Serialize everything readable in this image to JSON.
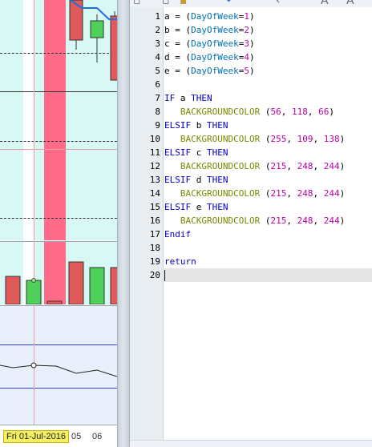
{
  "chart": {
    "date_axis": {
      "highlight_label": "Fri 01-Jul-2016",
      "ticks": [
        "05",
        "06"
      ]
    },
    "colors": {
      "panel_bg": "#d7f8f4",
      "highlight_band": "#ff6b88",
      "bearish_candle": "#e05a5a",
      "bullish_candle": "#4fd05a",
      "moving_average": "#1f6fe0",
      "indicator_bg": "#eaf0fb"
    }
  },
  "editor": {
    "line_numbers": [
      "1",
      "2",
      "3",
      "4",
      "5",
      "6",
      "7",
      "8",
      "9",
      "10",
      "11",
      "12",
      "13",
      "14",
      "15",
      "16",
      "17",
      "18",
      "19",
      "20"
    ],
    "current_line": 20,
    "lines": [
      [
        {
          "t": "a = (",
          "c": "plain"
        },
        {
          "t": "DayOfWeek",
          "c": "fn"
        },
        {
          "t": "=",
          "c": "plain"
        },
        {
          "t": "1",
          "c": "num"
        },
        {
          "t": ")",
          "c": "plain"
        }
      ],
      [
        {
          "t": "b = (",
          "c": "plain"
        },
        {
          "t": "DayOfWeek",
          "c": "fn"
        },
        {
          "t": "=",
          "c": "plain"
        },
        {
          "t": "2",
          "c": "num"
        },
        {
          "t": ")",
          "c": "plain"
        }
      ],
      [
        {
          "t": "c = (",
          "c": "plain"
        },
        {
          "t": "DayOfWeek",
          "c": "fn"
        },
        {
          "t": "=",
          "c": "plain"
        },
        {
          "t": "3",
          "c": "num"
        },
        {
          "t": ")",
          "c": "plain"
        }
      ],
      [
        {
          "t": "d = (",
          "c": "plain"
        },
        {
          "t": "DayOfWeek",
          "c": "fn"
        },
        {
          "t": "=",
          "c": "plain"
        },
        {
          "t": "4",
          "c": "num"
        },
        {
          "t": ")",
          "c": "plain"
        }
      ],
      [
        {
          "t": "e = (",
          "c": "plain"
        },
        {
          "t": "DayOfWeek",
          "c": "fn"
        },
        {
          "t": "=",
          "c": "plain"
        },
        {
          "t": "5",
          "c": "num"
        },
        {
          "t": ")",
          "c": "plain"
        }
      ],
      [],
      [
        {
          "t": "IF",
          "c": "kw"
        },
        {
          "t": " a ",
          "c": "plain"
        },
        {
          "t": "THEN",
          "c": "kw"
        }
      ],
      [
        {
          "t": "   ",
          "c": "plain"
        },
        {
          "t": "BACKGROUNDCOLOR",
          "c": "bg"
        },
        {
          "t": " (",
          "c": "plain"
        },
        {
          "t": "56",
          "c": "num"
        },
        {
          "t": ", ",
          "c": "plain"
        },
        {
          "t": "118",
          "c": "num"
        },
        {
          "t": ", ",
          "c": "plain"
        },
        {
          "t": "66",
          "c": "num"
        },
        {
          "t": ")",
          "c": "plain"
        }
      ],
      [
        {
          "t": "ELSIF",
          "c": "kw"
        },
        {
          "t": " b ",
          "c": "plain"
        },
        {
          "t": "THEN",
          "c": "kw"
        }
      ],
      [
        {
          "t": "   ",
          "c": "plain"
        },
        {
          "t": "BACKGROUNDCOLOR",
          "c": "bg"
        },
        {
          "t": " (",
          "c": "plain"
        },
        {
          "t": "255",
          "c": "num"
        },
        {
          "t": ", ",
          "c": "plain"
        },
        {
          "t": "109",
          "c": "num"
        },
        {
          "t": ", ",
          "c": "plain"
        },
        {
          "t": "138",
          "c": "num"
        },
        {
          "t": ")",
          "c": "plain"
        }
      ],
      [
        {
          "t": "ELSIF",
          "c": "kw"
        },
        {
          "t": " c ",
          "c": "plain"
        },
        {
          "t": "THEN",
          "c": "kw"
        }
      ],
      [
        {
          "t": "   ",
          "c": "plain"
        },
        {
          "t": "BACKGROUNDCOLOR",
          "c": "bg"
        },
        {
          "t": " (",
          "c": "plain"
        },
        {
          "t": "215",
          "c": "num"
        },
        {
          "t": ", ",
          "c": "plain"
        },
        {
          "t": "248",
          "c": "num"
        },
        {
          "t": ", ",
          "c": "plain"
        },
        {
          "t": "244",
          "c": "num"
        },
        {
          "t": ")",
          "c": "plain"
        }
      ],
      [
        {
          "t": "ELSIF",
          "c": "kw"
        },
        {
          "t": " d ",
          "c": "plain"
        },
        {
          "t": "THEN",
          "c": "kw"
        }
      ],
      [
        {
          "t": "   ",
          "c": "plain"
        },
        {
          "t": "BACKGROUNDCOLOR",
          "c": "bg"
        },
        {
          "t": " (",
          "c": "plain"
        },
        {
          "t": "215",
          "c": "num"
        },
        {
          "t": ", ",
          "c": "plain"
        },
        {
          "t": "248",
          "c": "num"
        },
        {
          "t": ", ",
          "c": "plain"
        },
        {
          "t": "244",
          "c": "num"
        },
        {
          "t": ")",
          "c": "plain"
        }
      ],
      [
        {
          "t": "ELSIF",
          "c": "kw"
        },
        {
          "t": " e ",
          "c": "plain"
        },
        {
          "t": "THEN",
          "c": "kw"
        }
      ],
      [
        {
          "t": "   ",
          "c": "plain"
        },
        {
          "t": "BACKGROUNDCOLOR",
          "c": "bg"
        },
        {
          "t": " (",
          "c": "plain"
        },
        {
          "t": "215",
          "c": "num"
        },
        {
          "t": ", ",
          "c": "plain"
        },
        {
          "t": "248",
          "c": "num"
        },
        {
          "t": ", ",
          "c": "plain"
        },
        {
          "t": "244",
          "c": "num"
        },
        {
          "t": ")",
          "c": "plain"
        }
      ],
      [
        {
          "t": "Endif",
          "c": "kw"
        }
      ],
      [],
      [
        {
          "t": "return",
          "c": "kw"
        }
      ],
      []
    ],
    "syntax_colors": {
      "keyword": "#0000c8",
      "function": "#0070b0",
      "number": "#c000a8",
      "backgroundcolor": "#7a8a00"
    }
  }
}
